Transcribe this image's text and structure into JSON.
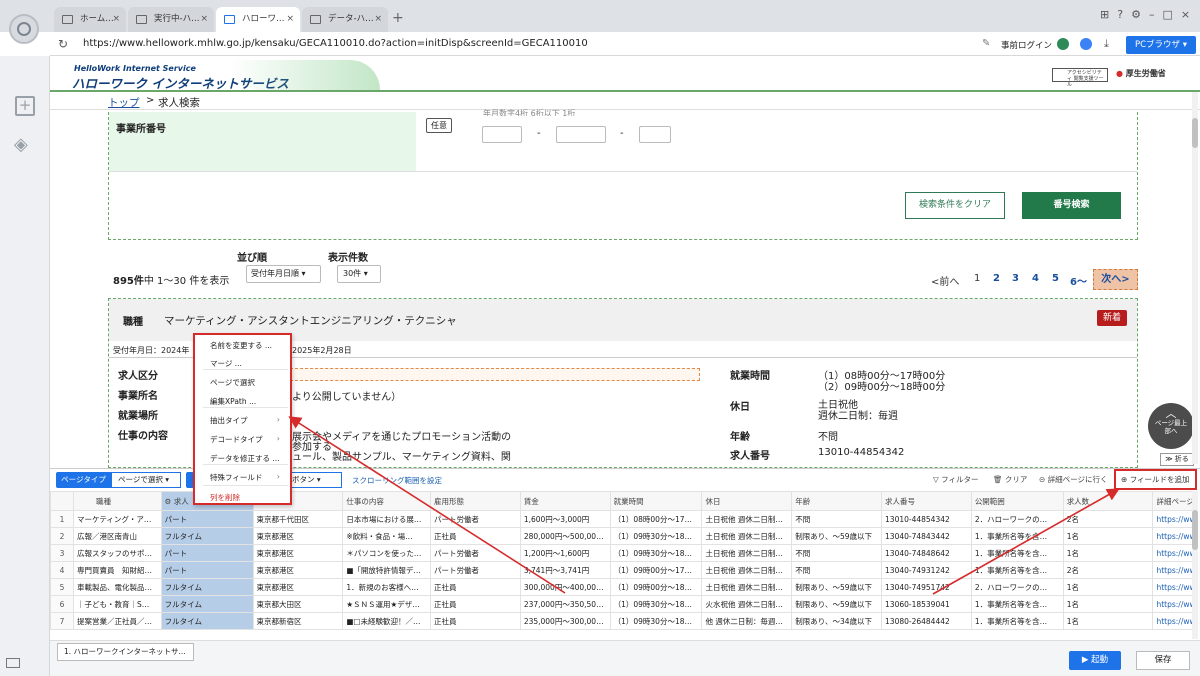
{
  "browser": {
    "tabs": [
      {
        "label": "ホーム…",
        "active": false
      },
      {
        "label": "実行中-ハ…",
        "active": false
      },
      {
        "label": "ハローワ…",
        "active": true
      },
      {
        "label": "データ-ハ…",
        "active": false
      }
    ],
    "new_tab": "+",
    "url": "https://www.hellowork.mhlw.go.jp/kensaku/GECA110010.do?action=initDisp&screenId=GECA110010",
    "login_label": "事前ログイン",
    "pc_browser_label": "PCブラウザ"
  },
  "site": {
    "logo_en": "HelloWork Internet Service",
    "logo_jp": "ハローワーク インターネットサービス",
    "badge_left": "アクセシビリティ 閲覧支援ツール",
    "badge_right": "厚生労働省",
    "breadcrumb_top": "トップ",
    "breadcrumb_sep": ">",
    "breadcrumb_current": "求人検索"
  },
  "search_form": {
    "partial_text": "年月数字4桁  6桁以下 1桁",
    "office_number_label": "事業所番号",
    "optional_badge": "任意",
    "dash": "-",
    "clear_button": "検索条件をクリア",
    "number_search_button": "番号検索"
  },
  "results": {
    "sort_label": "並び順",
    "sort_value": "受付年月日順",
    "count_label": "表示件数",
    "count_value": "30件",
    "total": "895件",
    "range_text": "中 1〜30 件を表示",
    "pagination": {
      "prev": "<前へ",
      "pages": [
        "1",
        "2",
        "3",
        "4",
        "5",
        "6〜"
      ],
      "next": "次へ>"
    }
  },
  "job_card": {
    "occupation_label": "職種",
    "occupation_value": "マーケティング・アシスタントエンジニアリング・テクニシャ",
    "new_badge": "新着",
    "received_prefix": "受付年月日：2024年",
    "received_suffix": "2025年2月28日",
    "labels": {
      "category": "求人区分",
      "office": "事業所名",
      "location": "就業場所",
      "description": "仕事の内容"
    },
    "office_value_partial": "より公開していません）",
    "description_partial1": "展示会やメディアを通じたプロモーション活動の",
    "description_partial2": "参加する",
    "description_partial3": "ュール、製品サンプル、マーケティング資料、関",
    "hours_label": "就業時間",
    "hours_value1": "（1）08時00分〜17時00分",
    "hours_value2": "（2）09時00分〜18時00分",
    "holiday_label": "休日",
    "holiday_value1": "土日祝他",
    "holiday_value2": "週休二日制：毎週",
    "age_label": "年齢",
    "age_value": "不問",
    "number_label": "求人番号",
    "number_value": "13010-44854342"
  },
  "float": {
    "top_button": "ページ最上部へ",
    "fold_label": "折る"
  },
  "panel": {
    "page_type_label": "ページタイプ",
    "page_type_value": "ページで選択",
    "button_type_partial": "ボタン",
    "scroll_range_link": "スクローリング範囲を設定",
    "filter": "フィルター",
    "clear": "クリア",
    "detail_page": "詳細ページに行く",
    "add_field": "フィールドを追加",
    "run_button": "起動",
    "save_button": "保存",
    "task_tab": "1. ハローワークインターネットサ..."
  },
  "context_menu": {
    "items": [
      {
        "label": "名前を変更する ...",
        "submenu": false,
        "danger": false
      },
      {
        "label": "マージ ...",
        "submenu": false,
        "danger": false
      },
      {
        "label": "ページで選択",
        "submenu": false,
        "danger": false
      },
      {
        "label": "編集XPath ...",
        "submenu": false,
        "danger": false
      },
      {
        "label": "抽出タイプ",
        "submenu": true,
        "danger": false
      },
      {
        "label": "デコードタイプ",
        "submenu": true,
        "danger": false
      },
      {
        "label": "データを修正する ...",
        "submenu": false,
        "danger": false
      },
      {
        "label": "特殊フィールド",
        "submenu": true,
        "danger": false
      },
      {
        "label": "列を削除",
        "submenu": false,
        "danger": true
      }
    ]
  },
  "table": {
    "headers": [
      "職種",
      "求人",
      "",
      "仕事の内容",
      "雇用形態",
      "賃金",
      "就業時間",
      "休日",
      "年齢",
      "求人番号",
      "公開範囲",
      "求人数",
      "詳細ページ"
    ],
    "rows": [
      [
        "1",
        "マーケティング・ア…",
        "パート",
        "東京都千代田区",
        "日本市場における展…",
        "パート労働者",
        "1,600円〜3,000円",
        "（1）08時00分〜17…",
        "土日祝他 週休二日制…",
        "不問",
        "13010-44854342",
        "2．ハローワークの…",
        "2名",
        "https://www.hellowork…"
      ],
      [
        "2",
        "広報／港区南青山",
        "フルタイム",
        "東京都港区",
        "※飲料・食品・場…",
        "正社員",
        "280,000円〜500,000円",
        "（1）09時30分〜18…",
        "土日祝他 週休二日制…",
        "制限あり、〜59歳以下",
        "13040-74843442",
        "1．事業所名等を含…",
        "1名",
        "https://www.hellowork…"
      ],
      [
        "3",
        "広報スタッフのサポ…",
        "パート",
        "東京都港区",
        "＊パソコンを使った…",
        "パート労働者",
        "1,200円〜1,600円",
        "（1）09時30分〜18…",
        "土日祝他 週休二日制…",
        "不問",
        "13040-74848642",
        "1．事業所名等を含…",
        "1名",
        "https://www.hellowork…"
      ],
      [
        "4",
        "専門買賣員　知財紹…",
        "パート",
        "東京都港区",
        "■「開放特許情報デ…",
        "パート労働者",
        "3,741円〜3,741円",
        "（1）09時00分〜17…",
        "土日祝他 週休二日制…",
        "不問",
        "13040-74931242",
        "1．事業所名等を含…",
        "2名",
        "https://www.hellowork…"
      ],
      [
        "5",
        "車載製品、電化製品…",
        "フルタイム",
        "東京都港区",
        "1．新規のお客様へ…",
        "正社員",
        "300,000円〜400,000円",
        "（1）09時00分〜18…",
        "土日祝他 週休二日制…",
        "制限あり、〜59歳以下",
        "13040-74951742",
        "2．ハローワークの…",
        "1名",
        "https://www.hellowork…"
      ],
      [
        "6",
        "｜子ども・教育｜S…",
        "フルタイム",
        "東京都大田区",
        "★ＳＮＳ運用★デザ…",
        "正社員",
        "237,000円〜350,500円",
        "（1）09時30分〜18…",
        "火水祝他 週休二日制…",
        "制限あり、〜59歳以下",
        "13060-18539041",
        "1．事業所名等を含…",
        "1名",
        "https://www.hellowork…"
      ],
      [
        "7",
        "提案営業／正社員／…",
        "フルタイム",
        "東京都新宿区",
        "■□未経験歓迎！／既…",
        "正社員",
        "235,000円〜300,000円",
        "（1）09時30分〜18…",
        "他 週休二日制：毎週…",
        "制限あり、〜34歳以下",
        "13080-26484442",
        "1．事業所名等を含…",
        "1名",
        "https://www.hellowork…"
      ]
    ]
  }
}
